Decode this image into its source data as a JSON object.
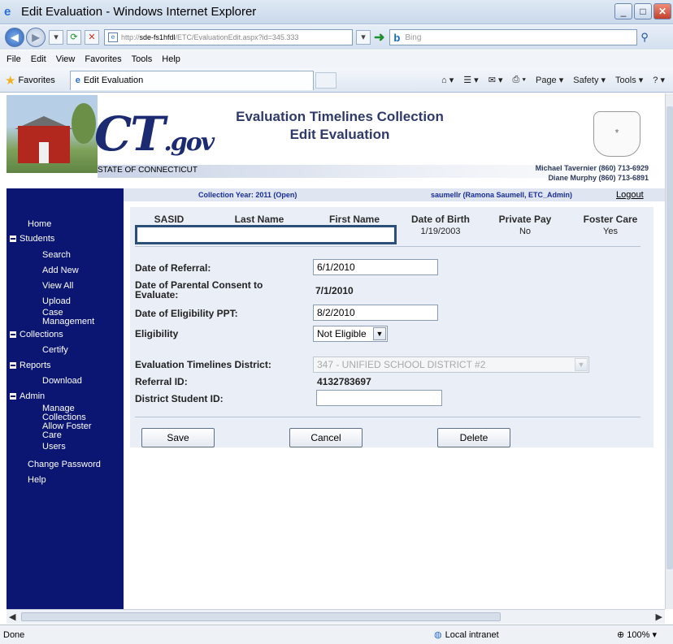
{
  "window": {
    "title": "Edit Evaluation - Windows Internet Explorer",
    "url_prefix": "http://",
    "url_host": "sde-fs1hfdl",
    "url_path": "/ETC/EvaluationEdit.aspx?id=345.333",
    "search_placeholder": "Bing"
  },
  "menu": [
    "File",
    "Edit",
    "View",
    "Favorites",
    "Tools",
    "Help"
  ],
  "favorites": {
    "label": "Favorites",
    "tab_title": "Edit Evaluation",
    "commands": [
      "Page ▾",
      "Safety ▾",
      "Tools ▾"
    ]
  },
  "status": {
    "text": "Done",
    "zone": "Local intranet",
    "zoom": "100%"
  },
  "header": {
    "title_line1": "Evaluation Timelines Collection",
    "title_line2": "Edit Evaluation",
    "state_name": "STATE OF CONNECTICUT",
    "logo_ct": "CT",
    "logo_gov": ".gov",
    "contact1": "Michael Tavernier (860) 713-6929",
    "contact2": "Diane Murphy (860) 713-6891"
  },
  "info": {
    "collection_year": "Collection Year: 2011 (Open)",
    "user": "saumellr (Ramona Saumell, ETC_Admin)",
    "logout": "Logout"
  },
  "nav": {
    "home": "Home",
    "students": "Students",
    "search": "Search",
    "add_new": "Add New",
    "view_all": "View All",
    "upload": "Upload",
    "case1": "Case",
    "case2": "Management",
    "collections": "Collections",
    "certify": "Certify",
    "reports": "Reports",
    "download": "Download",
    "admin": "Admin",
    "manage1": "Manage",
    "manage2": "Collections",
    "allow1": "Allow Foster",
    "allow2": "Care",
    "users": "Users",
    "change_password": "Change Password",
    "help": "Help"
  },
  "student": {
    "headers": [
      "SASID",
      "Last Name",
      "First Name",
      "Date of Birth",
      "Private Pay",
      "Foster Care"
    ],
    "dob": "1/19/2003",
    "private_pay": "No",
    "foster_care": "Yes"
  },
  "form": {
    "referral_label": "Date of Referral:",
    "referral_value": "6/1/2010",
    "consent_label1": "Date of Parental Consent to",
    "consent_label2": "Evaluate:",
    "consent_value": "7/1/2010",
    "ppt_label": "Date of Eligibility PPT:",
    "ppt_value": "8/2/2010",
    "eligibility_label": "Eligibility",
    "eligibility_value": "Not Eligible",
    "district_label": "Evaluation Timelines District:",
    "district_value": "347 - UNIFIED SCHOOL DISTRICT #2",
    "referral_id_label": "Referral ID:",
    "referral_id_value": "4132783697",
    "district_student_label": "District Student ID:",
    "district_student_value": ""
  },
  "buttons": {
    "save": "Save",
    "cancel": "Cancel",
    "delete": "Delete"
  }
}
